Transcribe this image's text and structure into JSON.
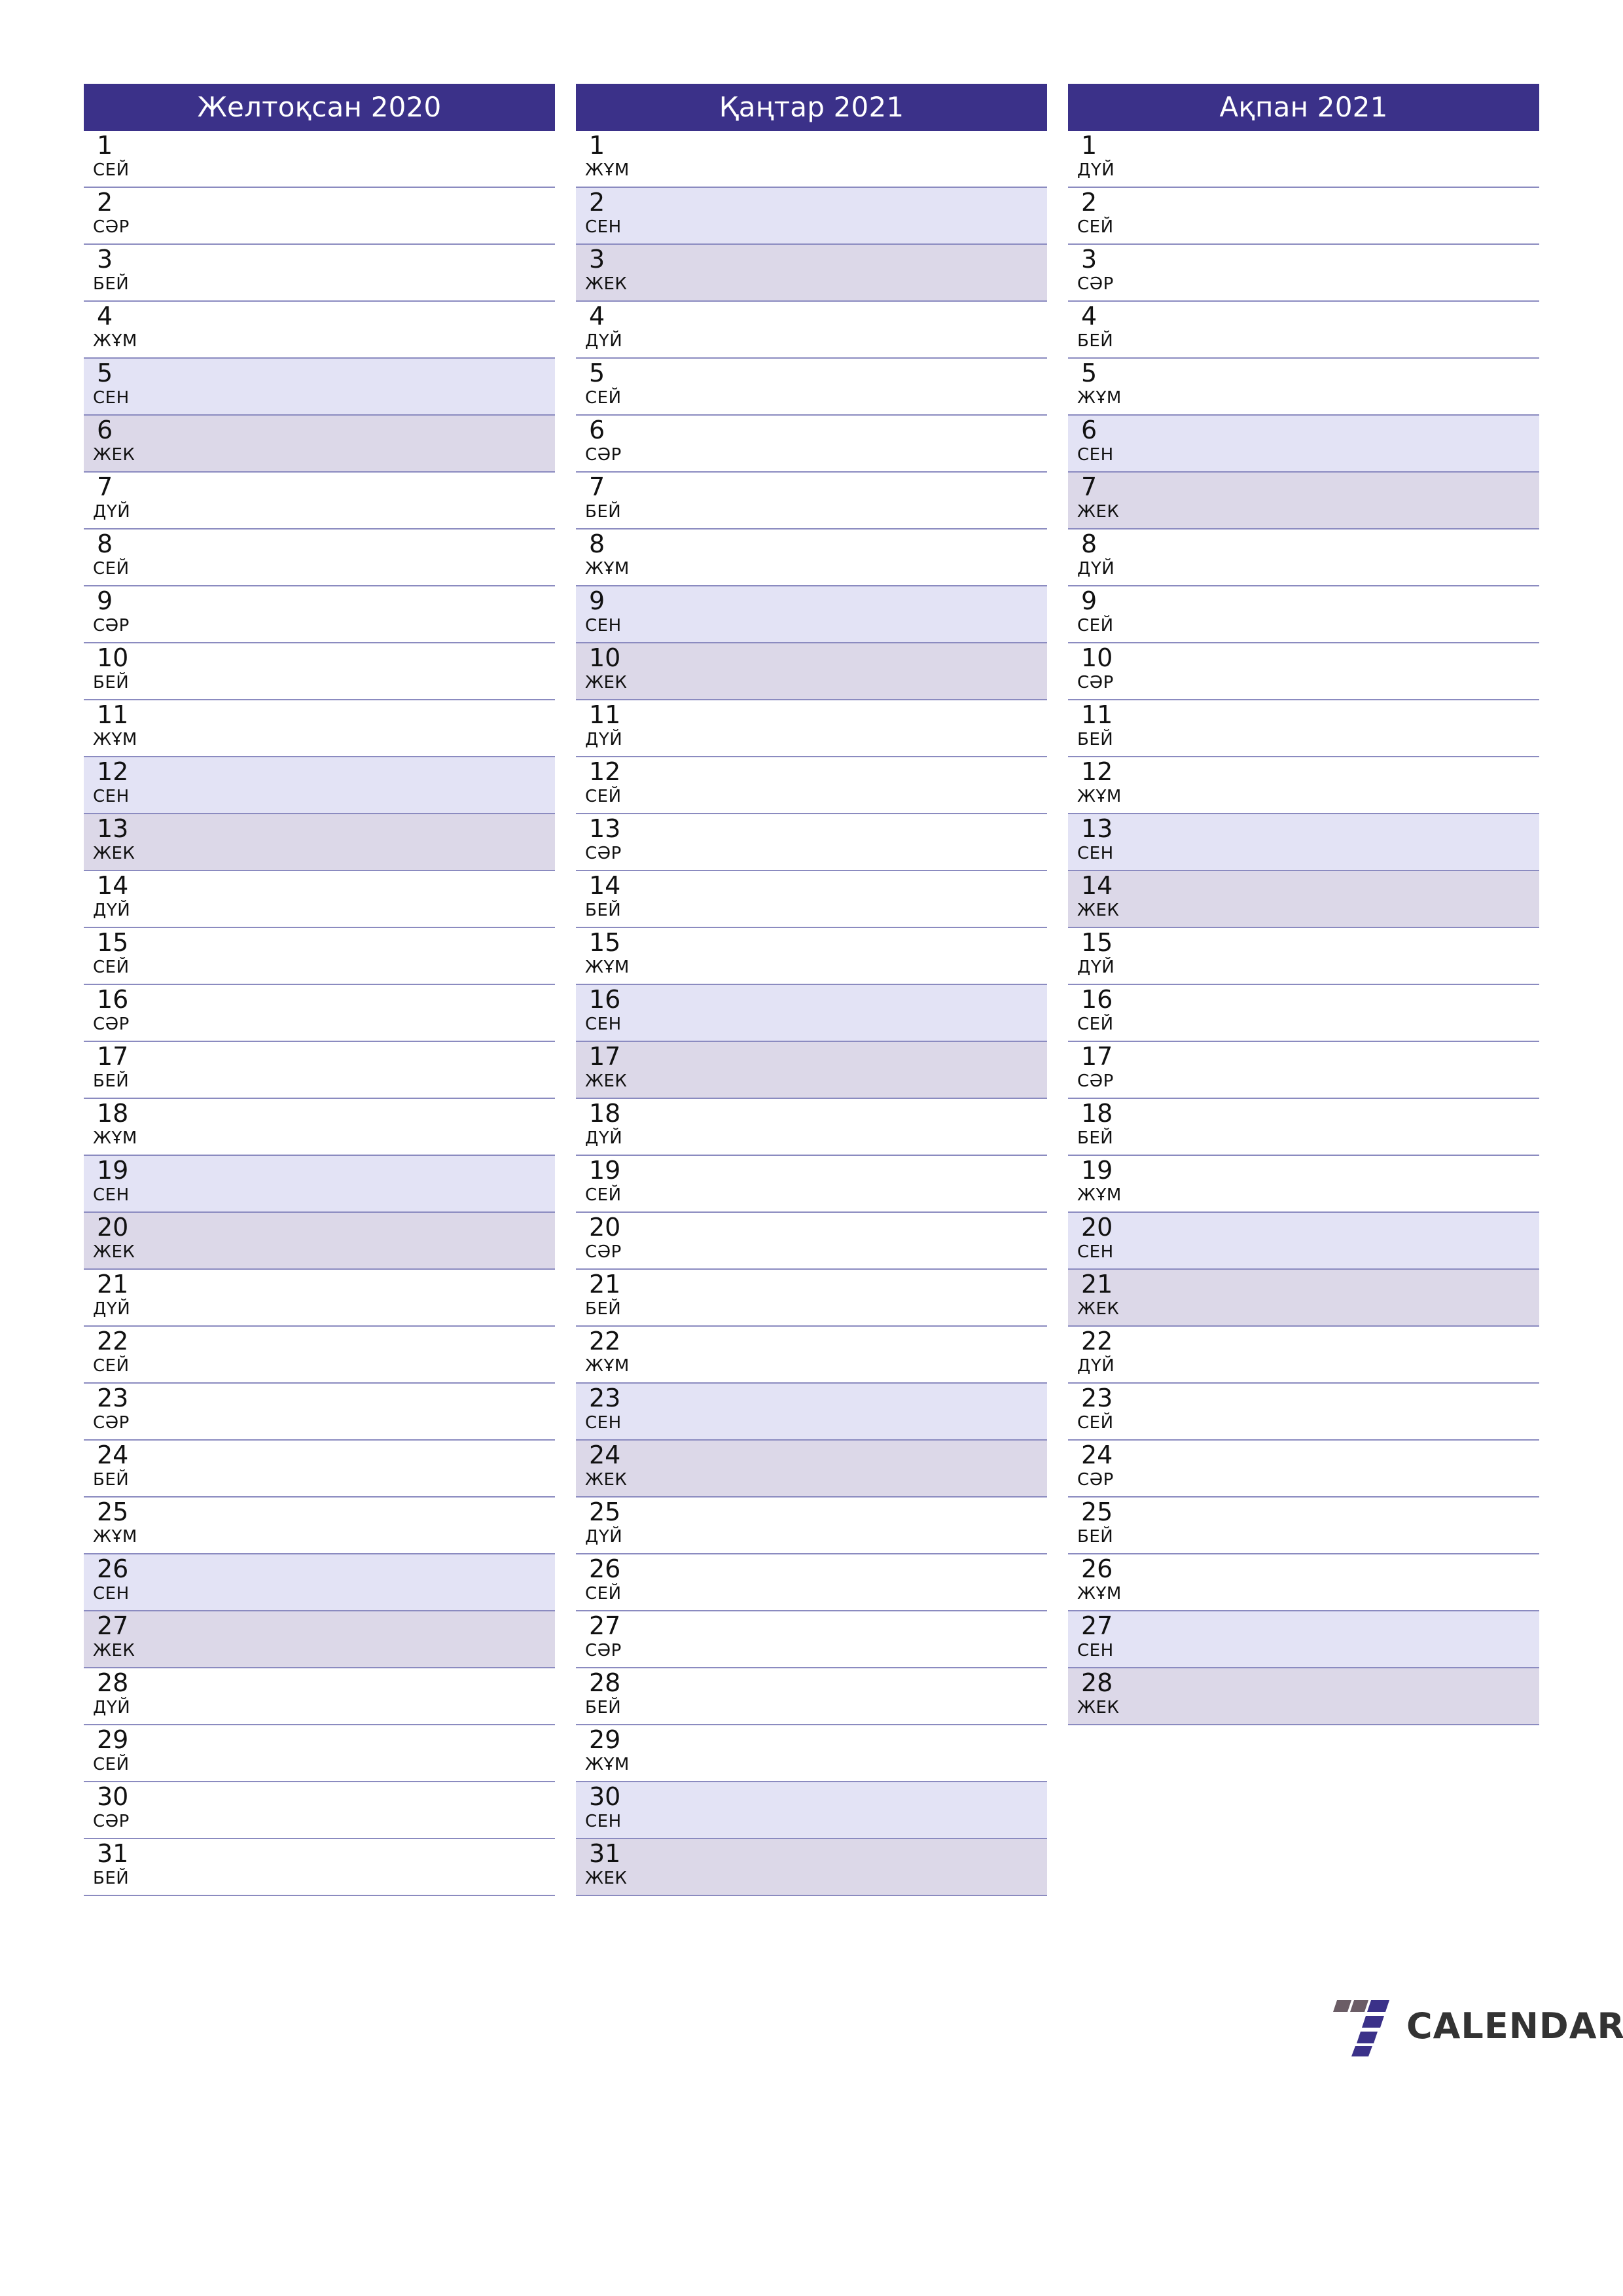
{
  "page": {
    "type": "three-month-planner",
    "language": "kk",
    "weekday_labels": {
      "mon": "ДҮЙ",
      "tue": "СЕЙ",
      "wed": "СӘР",
      "thu": "БЕЙ",
      "fri": "ЖҰМ",
      "sat": "СЕН",
      "sun": "ЖЕК"
    },
    "colors": {
      "header_bg": "#3b3189",
      "header_text": "#ffffff",
      "saturday_bg": "#e3e3f5",
      "sunday_bg": "#dcd8e8",
      "weekday_bg": "#ffffff",
      "rule": "#8b8bc0",
      "logo_indigo": "#3b3189",
      "logo_mauve": "#6b5d66",
      "logo_text": "#333333"
    }
  },
  "logo": {
    "mark_name": "seven-logo-icon",
    "text": "CALENDAR"
  },
  "months": [
    {
      "title": "Желтоқсан 2020",
      "days": [
        {
          "num": "1",
          "wd": "СЕЙ",
          "kind": "weekday"
        },
        {
          "num": "2",
          "wd": "СӘР",
          "kind": "weekday"
        },
        {
          "num": "3",
          "wd": "БЕЙ",
          "kind": "weekday"
        },
        {
          "num": "4",
          "wd": "ЖҰМ",
          "kind": "weekday"
        },
        {
          "num": "5",
          "wd": "СЕН",
          "kind": "sat"
        },
        {
          "num": "6",
          "wd": "ЖЕК",
          "kind": "sun"
        },
        {
          "num": "7",
          "wd": "ДҮЙ",
          "kind": "weekday"
        },
        {
          "num": "8",
          "wd": "СЕЙ",
          "kind": "weekday"
        },
        {
          "num": "9",
          "wd": "СӘР",
          "kind": "weekday"
        },
        {
          "num": "10",
          "wd": "БЕЙ",
          "kind": "weekday"
        },
        {
          "num": "11",
          "wd": "ЖҰМ",
          "kind": "weekday"
        },
        {
          "num": "12",
          "wd": "СЕН",
          "kind": "sat"
        },
        {
          "num": "13",
          "wd": "ЖЕК",
          "kind": "sun"
        },
        {
          "num": "14",
          "wd": "ДҮЙ",
          "kind": "weekday"
        },
        {
          "num": "15",
          "wd": "СЕЙ",
          "kind": "weekday"
        },
        {
          "num": "16",
          "wd": "СӘР",
          "kind": "weekday"
        },
        {
          "num": "17",
          "wd": "БЕЙ",
          "kind": "weekday"
        },
        {
          "num": "18",
          "wd": "ЖҰМ",
          "kind": "weekday"
        },
        {
          "num": "19",
          "wd": "СЕН",
          "kind": "sat"
        },
        {
          "num": "20",
          "wd": "ЖЕК",
          "kind": "sun"
        },
        {
          "num": "21",
          "wd": "ДҮЙ",
          "kind": "weekday"
        },
        {
          "num": "22",
          "wd": "СЕЙ",
          "kind": "weekday"
        },
        {
          "num": "23",
          "wd": "СӘР",
          "kind": "weekday"
        },
        {
          "num": "24",
          "wd": "БЕЙ",
          "kind": "weekday"
        },
        {
          "num": "25",
          "wd": "ЖҰМ",
          "kind": "weekday"
        },
        {
          "num": "26",
          "wd": "СЕН",
          "kind": "sat"
        },
        {
          "num": "27",
          "wd": "ЖЕК",
          "kind": "sun"
        },
        {
          "num": "28",
          "wd": "ДҮЙ",
          "kind": "weekday"
        },
        {
          "num": "29",
          "wd": "СЕЙ",
          "kind": "weekday"
        },
        {
          "num": "30",
          "wd": "СӘР",
          "kind": "weekday"
        },
        {
          "num": "31",
          "wd": "БЕЙ",
          "kind": "weekday"
        }
      ]
    },
    {
      "title": "Қаңтар 2021",
      "days": [
        {
          "num": "1",
          "wd": "ЖҰМ",
          "kind": "weekday"
        },
        {
          "num": "2",
          "wd": "СЕН",
          "kind": "sat"
        },
        {
          "num": "3",
          "wd": "ЖЕК",
          "kind": "sun"
        },
        {
          "num": "4",
          "wd": "ДҮЙ",
          "kind": "weekday"
        },
        {
          "num": "5",
          "wd": "СЕЙ",
          "kind": "weekday"
        },
        {
          "num": "6",
          "wd": "СӘР",
          "kind": "weekday"
        },
        {
          "num": "7",
          "wd": "БЕЙ",
          "kind": "weekday"
        },
        {
          "num": "8",
          "wd": "ЖҰМ",
          "kind": "weekday"
        },
        {
          "num": "9",
          "wd": "СЕН",
          "kind": "sat"
        },
        {
          "num": "10",
          "wd": "ЖЕК",
          "kind": "sun"
        },
        {
          "num": "11",
          "wd": "ДҮЙ",
          "kind": "weekday"
        },
        {
          "num": "12",
          "wd": "СЕЙ",
          "kind": "weekday"
        },
        {
          "num": "13",
          "wd": "СӘР",
          "kind": "weekday"
        },
        {
          "num": "14",
          "wd": "БЕЙ",
          "kind": "weekday"
        },
        {
          "num": "15",
          "wd": "ЖҰМ",
          "kind": "weekday"
        },
        {
          "num": "16",
          "wd": "СЕН",
          "kind": "sat"
        },
        {
          "num": "17",
          "wd": "ЖЕК",
          "kind": "sun"
        },
        {
          "num": "18",
          "wd": "ДҮЙ",
          "kind": "weekday"
        },
        {
          "num": "19",
          "wd": "СЕЙ",
          "kind": "weekday"
        },
        {
          "num": "20",
          "wd": "СӘР",
          "kind": "weekday"
        },
        {
          "num": "21",
          "wd": "БЕЙ",
          "kind": "weekday"
        },
        {
          "num": "22",
          "wd": "ЖҰМ",
          "kind": "weekday"
        },
        {
          "num": "23",
          "wd": "СЕН",
          "kind": "sat"
        },
        {
          "num": "24",
          "wd": "ЖЕК",
          "kind": "sun"
        },
        {
          "num": "25",
          "wd": "ДҮЙ",
          "kind": "weekday"
        },
        {
          "num": "26",
          "wd": "СЕЙ",
          "kind": "weekday"
        },
        {
          "num": "27",
          "wd": "СӘР",
          "kind": "weekday"
        },
        {
          "num": "28",
          "wd": "БЕЙ",
          "kind": "weekday"
        },
        {
          "num": "29",
          "wd": "ЖҰМ",
          "kind": "weekday"
        },
        {
          "num": "30",
          "wd": "СЕН",
          "kind": "sat"
        },
        {
          "num": "31",
          "wd": "ЖЕК",
          "kind": "sun"
        }
      ]
    },
    {
      "title": "Ақпан 2021",
      "days": [
        {
          "num": "1",
          "wd": "ДҮЙ",
          "kind": "weekday"
        },
        {
          "num": "2",
          "wd": "СЕЙ",
          "kind": "weekday"
        },
        {
          "num": "3",
          "wd": "СӘР",
          "kind": "weekday"
        },
        {
          "num": "4",
          "wd": "БЕЙ",
          "kind": "weekday"
        },
        {
          "num": "5",
          "wd": "ЖҰМ",
          "kind": "weekday"
        },
        {
          "num": "6",
          "wd": "СЕН",
          "kind": "sat"
        },
        {
          "num": "7",
          "wd": "ЖЕК",
          "kind": "sun"
        },
        {
          "num": "8",
          "wd": "ДҮЙ",
          "kind": "weekday"
        },
        {
          "num": "9",
          "wd": "СЕЙ",
          "kind": "weekday"
        },
        {
          "num": "10",
          "wd": "СӘР",
          "kind": "weekday"
        },
        {
          "num": "11",
          "wd": "БЕЙ",
          "kind": "weekday"
        },
        {
          "num": "12",
          "wd": "ЖҰМ",
          "kind": "weekday"
        },
        {
          "num": "13",
          "wd": "СЕН",
          "kind": "sat"
        },
        {
          "num": "14",
          "wd": "ЖЕК",
          "kind": "sun"
        },
        {
          "num": "15",
          "wd": "ДҮЙ",
          "kind": "weekday"
        },
        {
          "num": "16",
          "wd": "СЕЙ",
          "kind": "weekday"
        },
        {
          "num": "17",
          "wd": "СӘР",
          "kind": "weekday"
        },
        {
          "num": "18",
          "wd": "БЕЙ",
          "kind": "weekday"
        },
        {
          "num": "19",
          "wd": "ЖҰМ",
          "kind": "weekday"
        },
        {
          "num": "20",
          "wd": "СЕН",
          "kind": "sat"
        },
        {
          "num": "21",
          "wd": "ЖЕК",
          "kind": "sun"
        },
        {
          "num": "22",
          "wd": "ДҮЙ",
          "kind": "weekday"
        },
        {
          "num": "23",
          "wd": "СЕЙ",
          "kind": "weekday"
        },
        {
          "num": "24",
          "wd": "СӘР",
          "kind": "weekday"
        },
        {
          "num": "25",
          "wd": "БЕЙ",
          "kind": "weekday"
        },
        {
          "num": "26",
          "wd": "ЖҰМ",
          "kind": "weekday"
        },
        {
          "num": "27",
          "wd": "СЕН",
          "kind": "sat"
        },
        {
          "num": "28",
          "wd": "ЖЕК",
          "kind": "sun"
        }
      ]
    }
  ]
}
